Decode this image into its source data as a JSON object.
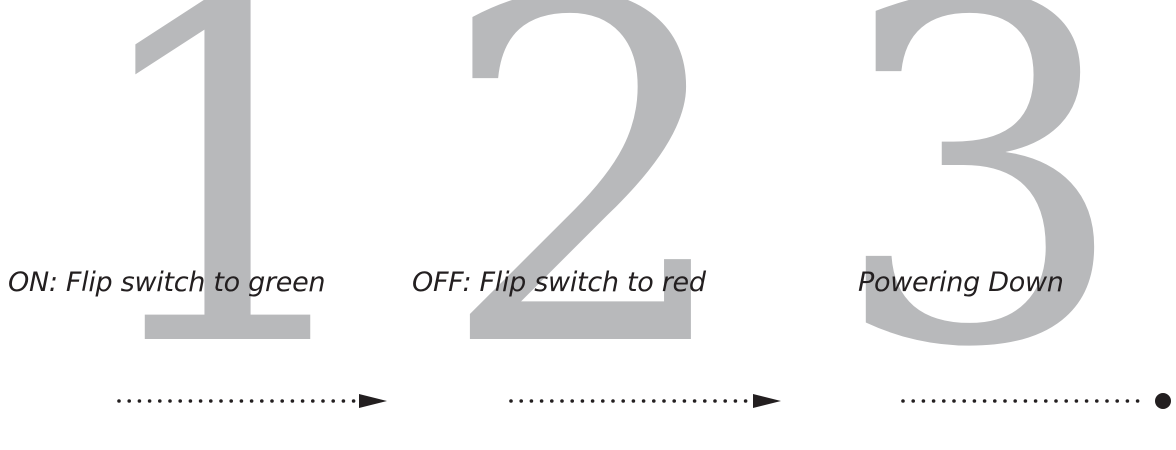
{
  "steps": [
    {
      "number": "1",
      "label": "ON: Flip switch to green",
      "connector_end": "arrow"
    },
    {
      "number": "2",
      "label": "OFF: Flip switch to red",
      "connector_end": "arrow"
    },
    {
      "number": "3",
      "label": "Powering Down",
      "connector_end": "dot"
    }
  ],
  "colors": {
    "number": "#b8b9bb",
    "text": "#231f20"
  }
}
